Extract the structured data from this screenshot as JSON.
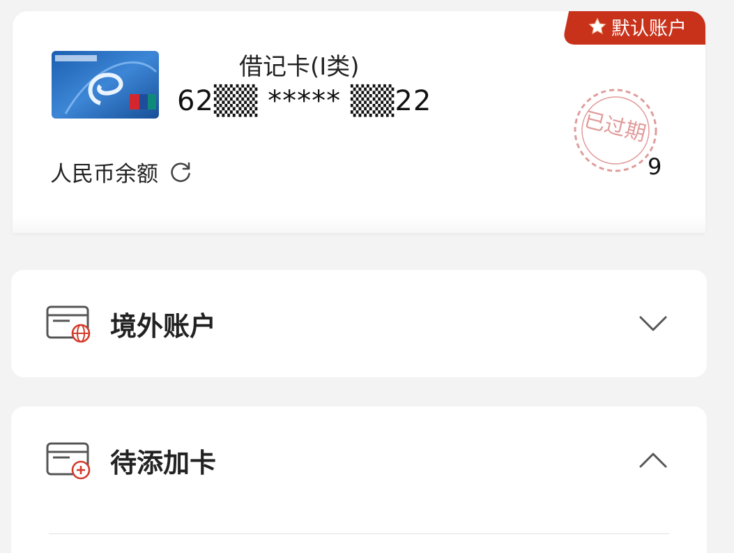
{
  "default_account": {
    "badge_label": "默认账户",
    "card_type": "借记卡(Ⅰ类)",
    "card_number": "62▒▒ ***** ▒▒22",
    "balance_label": "人民币余额",
    "balance_value": "9",
    "stamp_text": "已过期",
    "badge_color": "#c8321b"
  },
  "sections": {
    "overseas": {
      "title": "境外账户",
      "state": "collapsed",
      "icon": "card-globe-icon"
    },
    "pending": {
      "title": "待添加卡",
      "state": "expanded",
      "icon": "card-add-icon"
    }
  },
  "icons": {
    "badge": "star-icon",
    "refresh": "refresh-icon",
    "expand": "chevron-down-icon",
    "collapse": "chevron-up-icon"
  }
}
